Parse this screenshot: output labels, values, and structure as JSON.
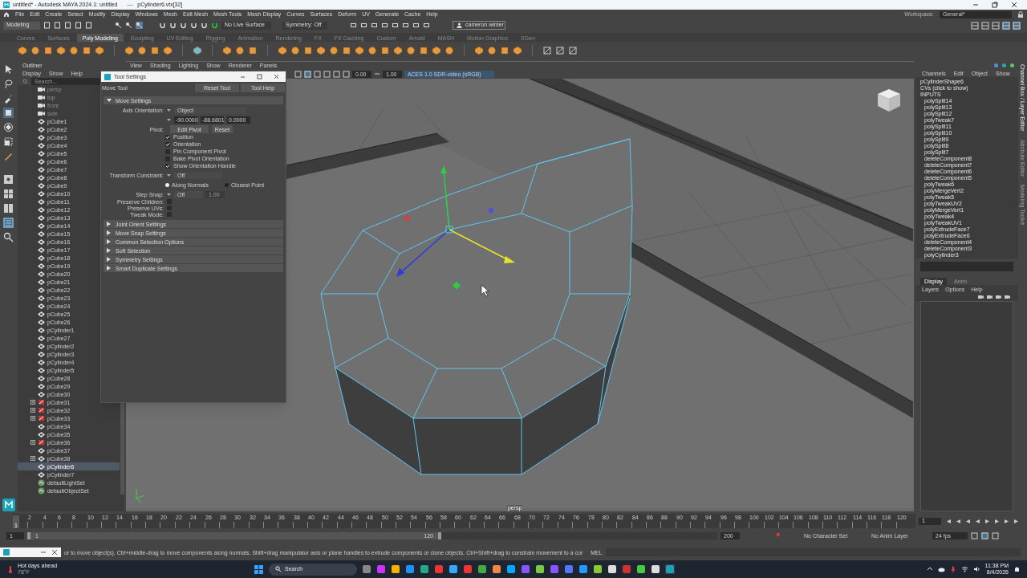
{
  "title_bar": {
    "title": "untitled* - Autodesk MAYA 2024.1: untitled",
    "selection": "---   pCylinder6.vtx[32]"
  },
  "menu_bar": [
    "File",
    "Edit",
    "Create",
    "Select",
    "Modify",
    "Display",
    "Windows",
    "Mesh",
    "Edit Mesh",
    "Mesh Tools",
    "Mesh Display",
    "Curves",
    "Surfaces",
    "Deform",
    "UV",
    "Generate",
    "Cache",
    "Help"
  ],
  "status_line": {
    "mode": "Modeling",
    "live_surface": "No Live Surface",
    "symmetry": "Symmetry: Off",
    "user": "cameron winter",
    "workspace_label": "Workspace:",
    "workspace": "General*"
  },
  "shelf_tabs": [
    {
      "label": "Curves",
      "selected": false
    },
    {
      "label": "Surfaces",
      "selected": false
    },
    {
      "label": "Poly Modeling",
      "selected": true
    },
    {
      "label": "Sculpting",
      "selected": false
    },
    {
      "label": "UV Editing",
      "selected": false
    },
    {
      "label": "Rigging",
      "selected": false
    },
    {
      "label": "Animation",
      "selected": false
    },
    {
      "label": "Rendering",
      "selected": false
    },
    {
      "label": "FX",
      "selected": false
    },
    {
      "label": "FX Caching",
      "selected": false
    },
    {
      "label": "Custom",
      "selected": false
    },
    {
      "label": "Arnold",
      "selected": false
    },
    {
      "label": "MASH",
      "selected": false
    },
    {
      "label": "Motion Graphics",
      "selected": false
    },
    {
      "label": "XGen",
      "selected": false
    }
  ],
  "outliner": {
    "title": "Outliner",
    "menu": [
      "Display",
      "Show",
      "Help"
    ],
    "search_placeholder": "Search...",
    "items": [
      {
        "label": "persp",
        "kind": "camera",
        "selected": false
      },
      {
        "label": "top",
        "kind": "camera",
        "selected": false
      },
      {
        "label": "front",
        "kind": "camera",
        "selected": false
      },
      {
        "label": "side",
        "kind": "camera",
        "selected": false
      },
      {
        "label": "pCube1",
        "kind": "mesh",
        "selected": false
      },
      {
        "label": "pCube2",
        "kind": "mesh",
        "selected": false
      },
      {
        "label": "pCube3",
        "kind": "mesh",
        "selected": false
      },
      {
        "label": "pCube4",
        "kind": "mesh",
        "selected": false
      },
      {
        "label": "pCube5",
        "kind": "mesh",
        "selected": false
      },
      {
        "label": "pCube6",
        "kind": "mesh",
        "selected": false
      },
      {
        "label": "pCube7",
        "kind": "mesh",
        "selected": false
      },
      {
        "label": "pCube8",
        "kind": "mesh",
        "selected": false
      },
      {
        "label": "pCube9",
        "kind": "mesh",
        "selected": false
      },
      {
        "label": "pCube10",
        "kind": "mesh",
        "selected": false
      },
      {
        "label": "pCube11",
        "kind": "mesh",
        "selected": false
      },
      {
        "label": "pCube12",
        "kind": "mesh",
        "selected": false
      },
      {
        "label": "pCube13",
        "kind": "mesh",
        "selected": false
      },
      {
        "label": "pCube14",
        "kind": "mesh",
        "selected": false
      },
      {
        "label": "pCube15",
        "kind": "mesh",
        "selected": false
      },
      {
        "label": "pCube16",
        "kind": "mesh",
        "selected": false
      },
      {
        "label": "pCube17",
        "kind": "mesh",
        "selected": false
      },
      {
        "label": "pCube18",
        "kind": "mesh",
        "selected": false
      },
      {
        "label": "pCube19",
        "kind": "mesh",
        "selected": false
      },
      {
        "label": "pCube20",
        "kind": "mesh",
        "selected": false
      },
      {
        "label": "pCube21",
        "kind": "mesh",
        "selected": false
      },
      {
        "label": "pCube22",
        "kind": "mesh",
        "selected": false
      },
      {
        "label": "pCube23",
        "kind": "mesh",
        "selected": false
      },
      {
        "label": "pCube24",
        "kind": "mesh",
        "selected": false
      },
      {
        "label": "pCube25",
        "kind": "mesh",
        "selected": false
      },
      {
        "label": "pCube26",
        "kind": "mesh",
        "selected": false
      },
      {
        "label": "pCylinder1",
        "kind": "mesh",
        "selected": false
      },
      {
        "label": "pCube27",
        "kind": "mesh",
        "selected": false
      },
      {
        "label": "pCylinder2",
        "kind": "mesh",
        "selected": false
      },
      {
        "label": "pCylinder3",
        "kind": "mesh",
        "selected": false
      },
      {
        "label": "pCylinder4",
        "kind": "mesh",
        "selected": false
      },
      {
        "label": "pCylinder5",
        "kind": "mesh",
        "selected": false
      },
      {
        "label": "pCube28",
        "kind": "mesh",
        "selected": false
      },
      {
        "label": "pCube29",
        "kind": "mesh",
        "selected": false
      },
      {
        "label": "pCube30",
        "kind": "mesh",
        "selected": false
      },
      {
        "label": "pCube31",
        "kind": "group",
        "selected": false
      },
      {
        "label": "pCube32",
        "kind": "group",
        "selected": false
      },
      {
        "label": "pCube33",
        "kind": "group",
        "selected": false
      },
      {
        "label": "pCube34",
        "kind": "mesh",
        "selected": false
      },
      {
        "label": "pCube35",
        "kind": "mesh",
        "selected": false
      },
      {
        "label": "pCube36",
        "kind": "group",
        "selected": false
      },
      {
        "label": "pCube37",
        "kind": "mesh",
        "selected": false
      },
      {
        "label": "pCube38",
        "kind": "mesh_expandable",
        "selected": false
      },
      {
        "label": "pCylinder6",
        "kind": "mesh",
        "selected": true
      },
      {
        "label": "pCylinder7",
        "kind": "mesh",
        "selected": false
      },
      {
        "label": "defaultLightSet",
        "kind": "set",
        "selected": false
      },
      {
        "label": "defaultObjectSet",
        "kind": "set",
        "selected": false
      }
    ]
  },
  "tool_settings": {
    "title": "Tool Settings",
    "tool": "Move Tool",
    "buttons": [
      "Reset Tool",
      "Tool Help"
    ],
    "section": "Move Settings",
    "axis_orientation_label": "Axis Orientation:",
    "axis_orientation": "Object",
    "axis_values": [
      "-90.0000",
      "-88.6801",
      "0.0000"
    ],
    "pivot_label": "Pivot:",
    "pivot_buttons": [
      "Edit Pivot",
      "Reset"
    ],
    "pivot_options": [
      {
        "label": "Position",
        "checked": true
      },
      {
        "label": "Orientation",
        "checked": true
      },
      {
        "label": "Pin Component Pivot",
        "checked": false
      },
      {
        "label": "Bake Pivot Orientation",
        "checked": false
      },
      {
        "label": "Show Orientation Handle",
        "checked": true
      }
    ],
    "constraint_label": "Transform Constraint:",
    "constraint": "Off",
    "constraint_modes": [
      {
        "label": "Along Normals",
        "selected": true
      },
      {
        "label": "Closest Point",
        "selected": false
      }
    ],
    "step_snap_label": "Step Snap:",
    "step_snap": "Off",
    "step_value": "1.00",
    "preserve_options": [
      {
        "label": "Preserve Children:",
        "checked": false
      },
      {
        "label": "Preserve UVs:",
        "checked": false
      },
      {
        "label": "Tweak Mode:",
        "checked": false
      }
    ],
    "collapsed_sections": [
      "Joint Orient Settings",
      "Move Snap Settings",
      "Common Selection Options",
      "Soft Selection",
      "Symmetry Settings",
      "Smart Duplicate Settings"
    ]
  },
  "viewport": {
    "menu": [
      "View",
      "Shading",
      "Lighting",
      "Show",
      "Renderer",
      "Panels"
    ],
    "exposure": "0.00",
    "gamma": "1.00",
    "color_space": "ACES 1.0 SDR-video (sRGB)",
    "camera": "persp"
  },
  "channel_box": {
    "menu": [
      "Channels",
      "Edit",
      "Object",
      "Show"
    ],
    "node": "pCylinderShape6",
    "cvs": "CVs (click to show)",
    "inputs_header": "INPUTS",
    "inputs": [
      "polySplit14",
      "polySplit13",
      "polySplit12",
      "polyTweak7",
      "polySplit11",
      "polySplit10",
      "polySplit9",
      "polySplit8",
      "polySplit7",
      "deleteComponent8",
      "deleteComponent7",
      "deleteComponent6",
      "deleteComponent5",
      "polyTweak6",
      "polyMergeVert2",
      "polyTweak5",
      "polyTweakUV2",
      "polyMergeVert1",
      "polyTweak4",
      "polyTweakUV1",
      "polyExtrudeFace7",
      "polyExtrudeFace6",
      "deleteComponent4",
      "deleteComponent3",
      "polyCylinder3"
    ],
    "layer_tabs": [
      {
        "label": "Display",
        "selected": true
      },
      {
        "label": "Anim",
        "selected": false
      }
    ],
    "layer_menu": [
      "Layers",
      "Options",
      "Help"
    ],
    "side_tabs": [
      "Channel Box / Layer Editor",
      "Attribute Editor",
      "Modeling Toolkit"
    ]
  },
  "timeline": {
    "current_marker": "1",
    "ticks": [
      "2",
      "4",
      "6",
      "8",
      "10",
      "12",
      "14",
      "16",
      "18",
      "20",
      "22",
      "24",
      "26",
      "28",
      "30",
      "32",
      "34",
      "36",
      "38",
      "40",
      "42",
      "44",
      "46",
      "48",
      "50",
      "52",
      "54",
      "56",
      "58",
      "60",
      "62",
      "64",
      "66",
      "68",
      "70",
      "72",
      "74",
      "76",
      "78",
      "80",
      "82",
      "84",
      "86",
      "88",
      "90",
      "92",
      "94",
      "96",
      "98",
      "100",
      "102",
      "104",
      "106",
      "108",
      "110",
      "112",
      "114",
      "116",
      "118",
      "120"
    ],
    "current_frame": "1",
    "level": 0
  },
  "range_slider": {
    "level": 0.6,
    "start": "1",
    "slider_start": "1",
    "slider_end": "120",
    "end": "200",
    "character_set": "No Character Set",
    "anim_layer": "No Anim Layer",
    "fps": "24 fps"
  },
  "command_line": {
    "help": "or to move object(s). Ctrl+middle-drag to move components along normals. Shift+drag manipulator axis or plane handles to extrude components or clone objects. Ctrl+Shift+drag to constrain movement to a cor",
    "language": "MEL"
  },
  "taskbar": {
    "weather": "Hot days ahead",
    "temperature": "78°F",
    "search": "Search",
    "time": "11:38 PM",
    "date": "8/4/2026"
  }
}
